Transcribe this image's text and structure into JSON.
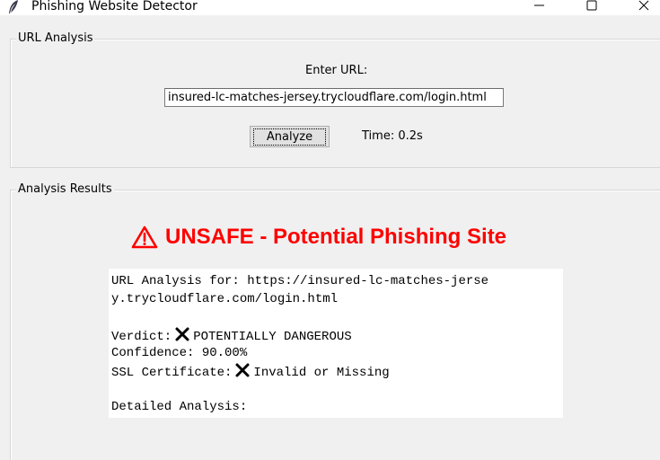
{
  "window": {
    "title": "Phishing Website Detector",
    "icon": "feather-icon"
  },
  "url_frame": {
    "label": "URL Analysis",
    "enter_label": "Enter URL:",
    "url_value": "insured-lc-matches-jersey.trycloudflare.com/login.html",
    "analyze_label": "Analyze",
    "time_text": "Time: 0.2s"
  },
  "results_frame": {
    "label": "Analysis Results",
    "verdict_text": "UNSAFE - Potential Phishing Site",
    "verdict_color": "#ff0000",
    "lines": {
      "l1": "URL Analysis for: https://insured-lc-matches-jerse",
      "l2": "y.trycloudflare.com/login.html",
      "verdict_label": "Verdict:",
      "verdict_value": "POTENTIALLY DANGEROUS",
      "confidence": "Confidence: 90.00%",
      "ssl_label": "SSL Certificate:",
      "ssl_value": "Invalid or Missing",
      "detailed": "Detailed Analysis:"
    }
  }
}
